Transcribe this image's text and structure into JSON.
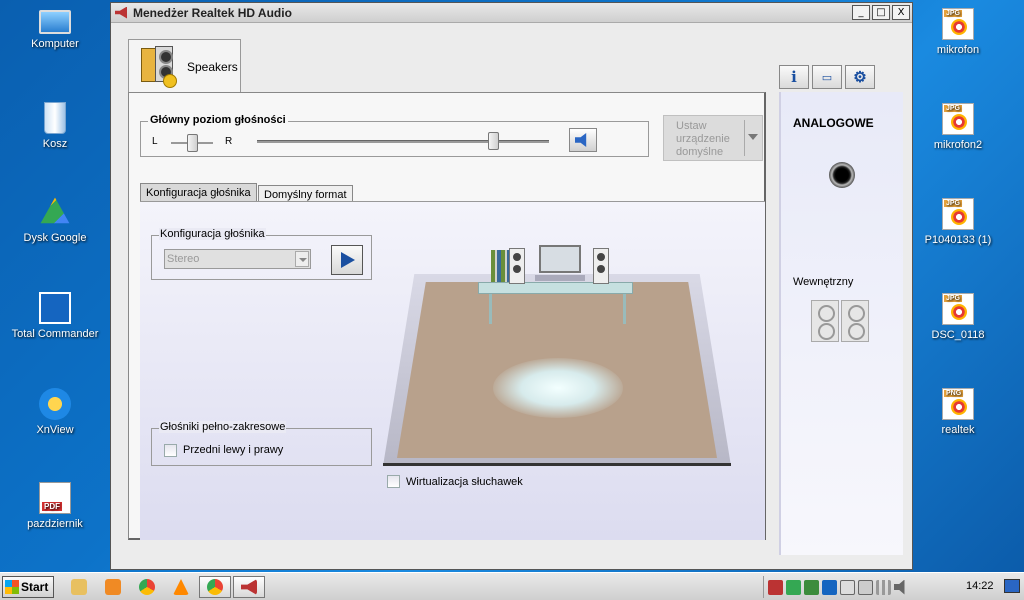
{
  "desktop": {
    "left_icons": [
      {
        "label": "Komputer",
        "icon": "computer-icon"
      },
      {
        "label": "Kosz",
        "icon": "recycle-bin-icon"
      },
      {
        "label": "Dysk Google",
        "icon": "google-drive-icon"
      },
      {
        "label": "Total Commander",
        "icon": "total-commander-icon"
      },
      {
        "label": "XnView",
        "icon": "xnview-icon"
      },
      {
        "label": "pazdziernik",
        "icon": "pdf-file-icon"
      }
    ],
    "right_icons": [
      {
        "label": "mikrofon",
        "ext": "JPG"
      },
      {
        "label": "mikrofon2",
        "ext": "JPG"
      },
      {
        "label": "P1040133 (1)",
        "ext": "JPG"
      },
      {
        "label": "DSC_0118",
        "ext": "JPG"
      },
      {
        "label": "realtek",
        "ext": "PNG"
      }
    ]
  },
  "window": {
    "title": "Menedżer Realtek HD Audio",
    "controls": {
      "minimize": "_",
      "maximize": "□",
      "close": "X"
    }
  },
  "device_tab": {
    "label": "Speakers"
  },
  "volume": {
    "legend": "Główny poziom głośności",
    "left_label": "L",
    "right_label": "R",
    "balance_level": 0.5,
    "master_level": 0.81
  },
  "set_default": {
    "label": "Ustaw urządzenie domyślne",
    "enabled": false
  },
  "subtabs": [
    {
      "label": "Konfiguracja głośnika",
      "active": true
    },
    {
      "label": "Domyślny format",
      "active": false
    }
  ],
  "speaker_config": {
    "legend": "Konfiguracja głośnika",
    "selected": "Stereo"
  },
  "full_range": {
    "legend": "Głośniki pełno-zakresowe",
    "option": "Przedni lewy i prawy",
    "checked": false
  },
  "headphone_virtualization": {
    "label": "Wirtualizacja słuchawek",
    "checked": false
  },
  "side_panel": {
    "analog_label": "ANALOGOWE",
    "internal_label": "Wewnętrzny"
  },
  "taskbar": {
    "start_label": "Start",
    "apps": [
      "file-explorer-icon",
      "media-player-icon",
      "chrome-icon",
      "vlc-icon",
      "chrome-icon",
      "realtek-audio-icon"
    ],
    "clock": "14:22"
  },
  "colors": {
    "accent": "#1a4fa0",
    "desktop": "#0d73c9",
    "window_bg": "#ececec"
  }
}
